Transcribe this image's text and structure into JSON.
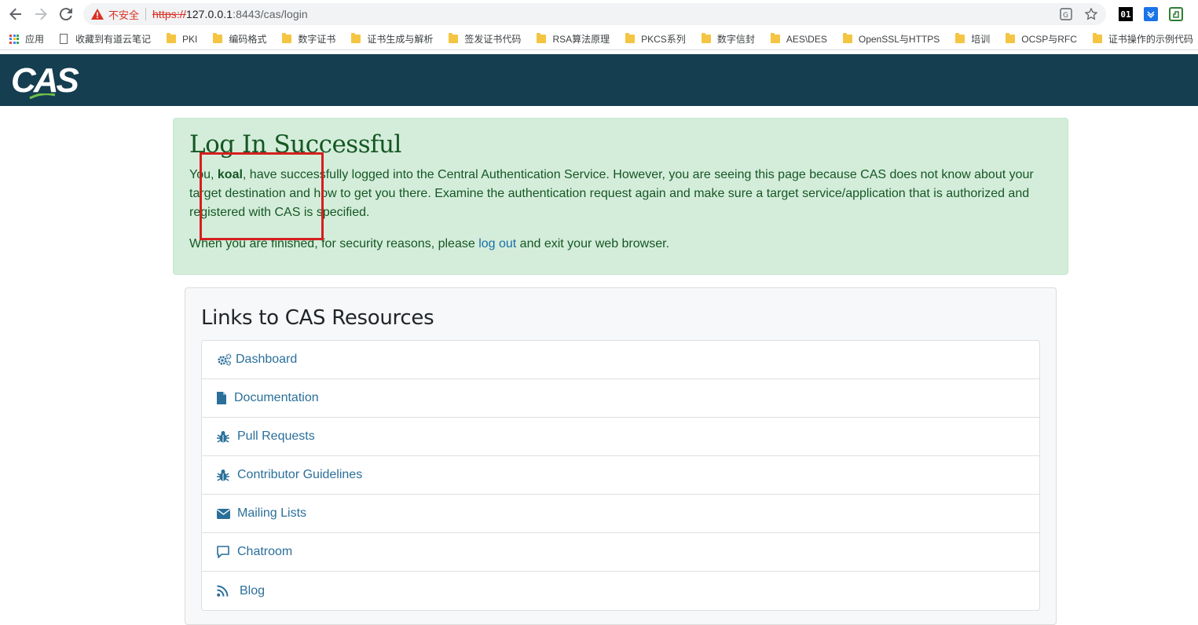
{
  "browser": {
    "security_label": "不安全",
    "url_scheme": "https://",
    "url_host": "127.0.0.1",
    "url_rest": ":8443/cas/login",
    "extensions": {
      "ext1_label": "01"
    }
  },
  "bookmarks": {
    "apps_label": "应用",
    "items": [
      "收藏到有道云笔记",
      "PKI",
      "编码格式",
      "数字证书",
      "证书生成与解析",
      "签发证书代码",
      "RSA算法原理",
      "PKCS系列",
      "数字信封",
      "AES\\DES",
      "OpenSSL与HTTPS",
      "培训",
      "OCSP与RFC",
      "证书操作的示例代码"
    ]
  },
  "header": {
    "logo_text": "CAS"
  },
  "success": {
    "title": "Log In Successful",
    "p1_prefix": "You, ",
    "username": "koal",
    "p1_suffix": ", have successfully logged into the Central Authentication Service. However, you are seeing this page because CAS does not know about your target destination and how to get you there. Examine the authentication request again and make sure a target service/application that is authorized and registered with CAS is specified.",
    "p2_prefix": "When you are finished, for security reasons, please ",
    "logout_link": "log out",
    "p2_suffix": " and exit your web browser."
  },
  "resources": {
    "title": "Links to CAS Resources",
    "items": [
      {
        "label": "Dashboard",
        "icon": "cogs-icon"
      },
      {
        "label": "Documentation",
        "icon": "file-icon"
      },
      {
        "label": "Pull Requests",
        "icon": "bug-icon"
      },
      {
        "label": "Contributor Guidelines",
        "icon": "bug-icon"
      },
      {
        "label": "Mailing Lists",
        "icon": "envelope-icon"
      },
      {
        "label": "Chatroom",
        "icon": "comment-icon"
      },
      {
        "label": "Blog",
        "icon": "rss-icon"
      }
    ]
  },
  "colors": {
    "header_bg": "#153e50",
    "success_bg": "#d4edda",
    "success_text": "#155724",
    "link": "#2a6f9a",
    "annotation": "#d61f1f"
  }
}
